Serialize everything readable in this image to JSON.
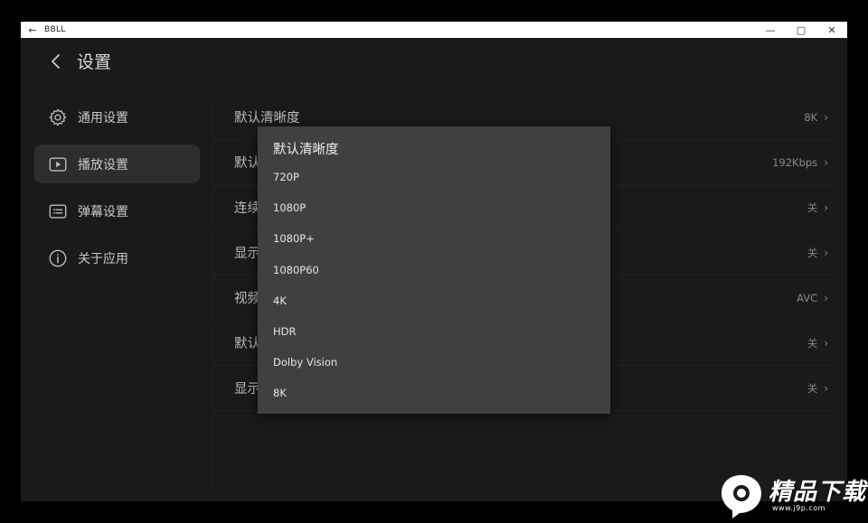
{
  "window": {
    "title": "BBLL",
    "controls": [
      "—",
      "▢",
      "✕"
    ]
  },
  "header": {
    "title": "设置"
  },
  "sidebar": {
    "items": [
      {
        "label": "通用设置",
        "icon": "gear-icon",
        "active": false
      },
      {
        "label": "播放设置",
        "icon": "play-icon",
        "active": true
      },
      {
        "label": "弹幕设置",
        "icon": "danmaku-icon",
        "active": false
      },
      {
        "label": "关于应用",
        "icon": "info-icon",
        "active": false
      }
    ]
  },
  "settings": {
    "rows": [
      {
        "label": "默认清晰度",
        "value": "8K"
      },
      {
        "label": "默认",
        "value": "192Kbps"
      },
      {
        "label": "连续",
        "value": "关"
      },
      {
        "label": "显示",
        "value": "关"
      },
      {
        "label": "视频",
        "value": "AVC"
      },
      {
        "label": "默认",
        "value": "关"
      },
      {
        "label": "显示",
        "value": "关"
      }
    ]
  },
  "dialog": {
    "title": "默认清晰度",
    "options": [
      "720P",
      "1080P",
      "1080P+",
      "1080P60",
      "4K",
      "HDR",
      "Dolby Vision",
      "8K"
    ]
  },
  "watermark": {
    "text": "精品下载",
    "url": "www.j9p.com"
  },
  "colors": {
    "background": "#1a1a1a",
    "active_item": "#2d2d2d",
    "dialog": "#404040"
  }
}
